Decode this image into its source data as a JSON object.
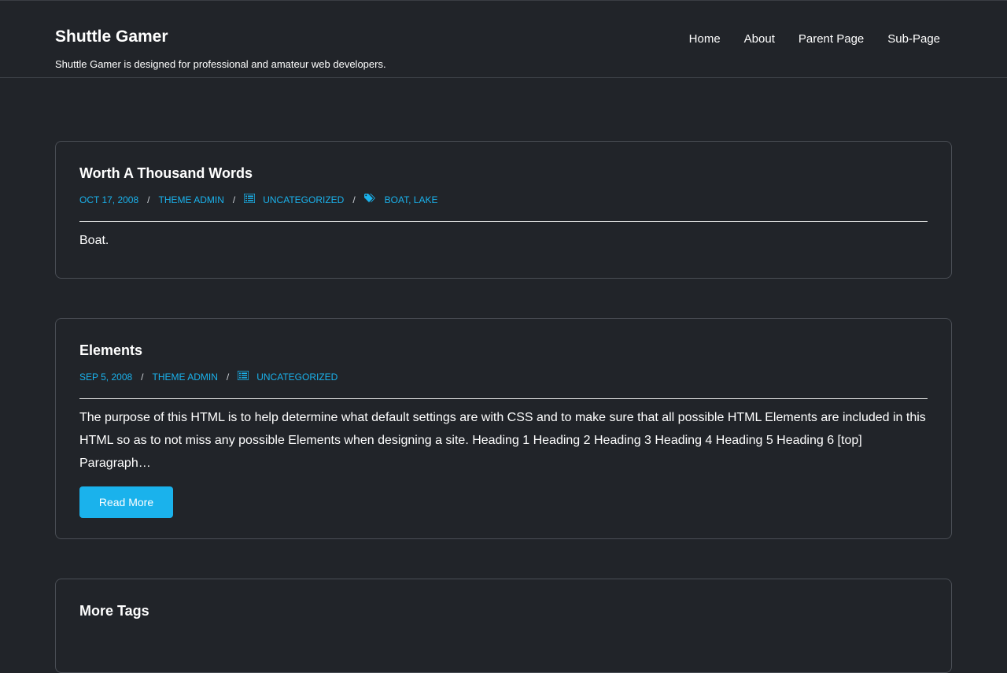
{
  "header": {
    "site_title": "Shuttle Gamer",
    "site_description": "Shuttle Gamer is designed for professional and amateur web developers.",
    "nav": [
      "Home",
      "About",
      "Parent Page",
      "Sub-Page"
    ]
  },
  "posts": [
    {
      "title": "Worth A Thousand Words",
      "date": "OCT 17, 2008",
      "author": "THEME ADMIN",
      "category": "UNCATEGORIZED",
      "tags": "BOAT, LAKE",
      "excerpt": "Boat."
    },
    {
      "title": "Elements",
      "date": "SEP 5, 2008",
      "author": "THEME ADMIN",
      "category": "UNCATEGORIZED",
      "excerpt": "The purpose of this HTML is to help determine what default settings are with CSS and to make sure that all possible HTML Elements are included in this HTML so as to not miss any possible Elements when designing a site. Heading 1 Heading 2 Heading 3 Heading 4 Heading 5 Heading 6 [top] Paragraph…",
      "read_more": "Read More"
    },
    {
      "title": "More Tags"
    }
  ],
  "meta_separator": "/",
  "icons": {
    "category": "list-icon",
    "tags": "tags-icon"
  },
  "colors": {
    "background": "#212429",
    "accent": "#1ab2ec",
    "text": "#ffffff",
    "border": "#4a4e55"
  }
}
